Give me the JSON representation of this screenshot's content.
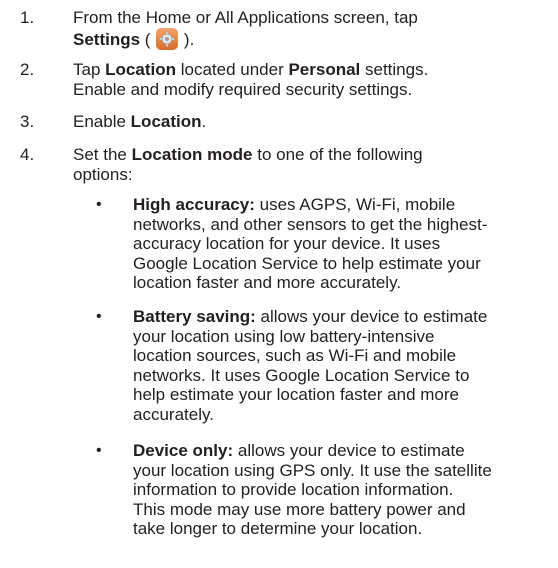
{
  "steps": [
    {
      "number": "1.",
      "line1_pre": "From the Home or All Applications screen, tap",
      "bold": "Settings",
      "paren_open": " (",
      "paren_close": ").",
      "icon": "settings-gear-icon"
    },
    {
      "number": "2.",
      "pre": "Tap ",
      "bold1": "Location",
      "mid": " located under ",
      "bold2": "Personal",
      "post": " settings.",
      "line2": "Enable and modify required security settings."
    },
    {
      "number": "3.",
      "pre": "Enable ",
      "bold": "Location",
      "post": "."
    },
    {
      "number": "4.",
      "pre": "Set the ",
      "bold": "Location mode",
      "post": " to one of the following",
      "line2": "options:"
    }
  ],
  "options": [
    {
      "bullet": "•",
      "title": "High accuracy:",
      "lines": [
        " uses AGPS, Wi-Fi, mobile",
        "networks, and other sensors to get the highest-",
        "accuracy location for your device. It uses",
        "Google Location Service to help estimate your",
        "location faster and more accurately."
      ]
    },
    {
      "bullet": "•",
      "title": "Battery saving:",
      "lines": [
        " allows your device to estimate",
        "your location using low battery-intensive",
        "location sources, such as Wi-Fi and mobile",
        "networks. It uses Google Location Service to",
        "help estimate your location faster and more",
        "accurately."
      ]
    },
    {
      "bullet": "•",
      "title": "Device only:",
      "lines": [
        " allows your device to estimate",
        "your location using GPS only. It use the satellite",
        "information to provide location information.",
        "This mode may use more battery power and",
        "take longer to determine your location."
      ]
    }
  ]
}
